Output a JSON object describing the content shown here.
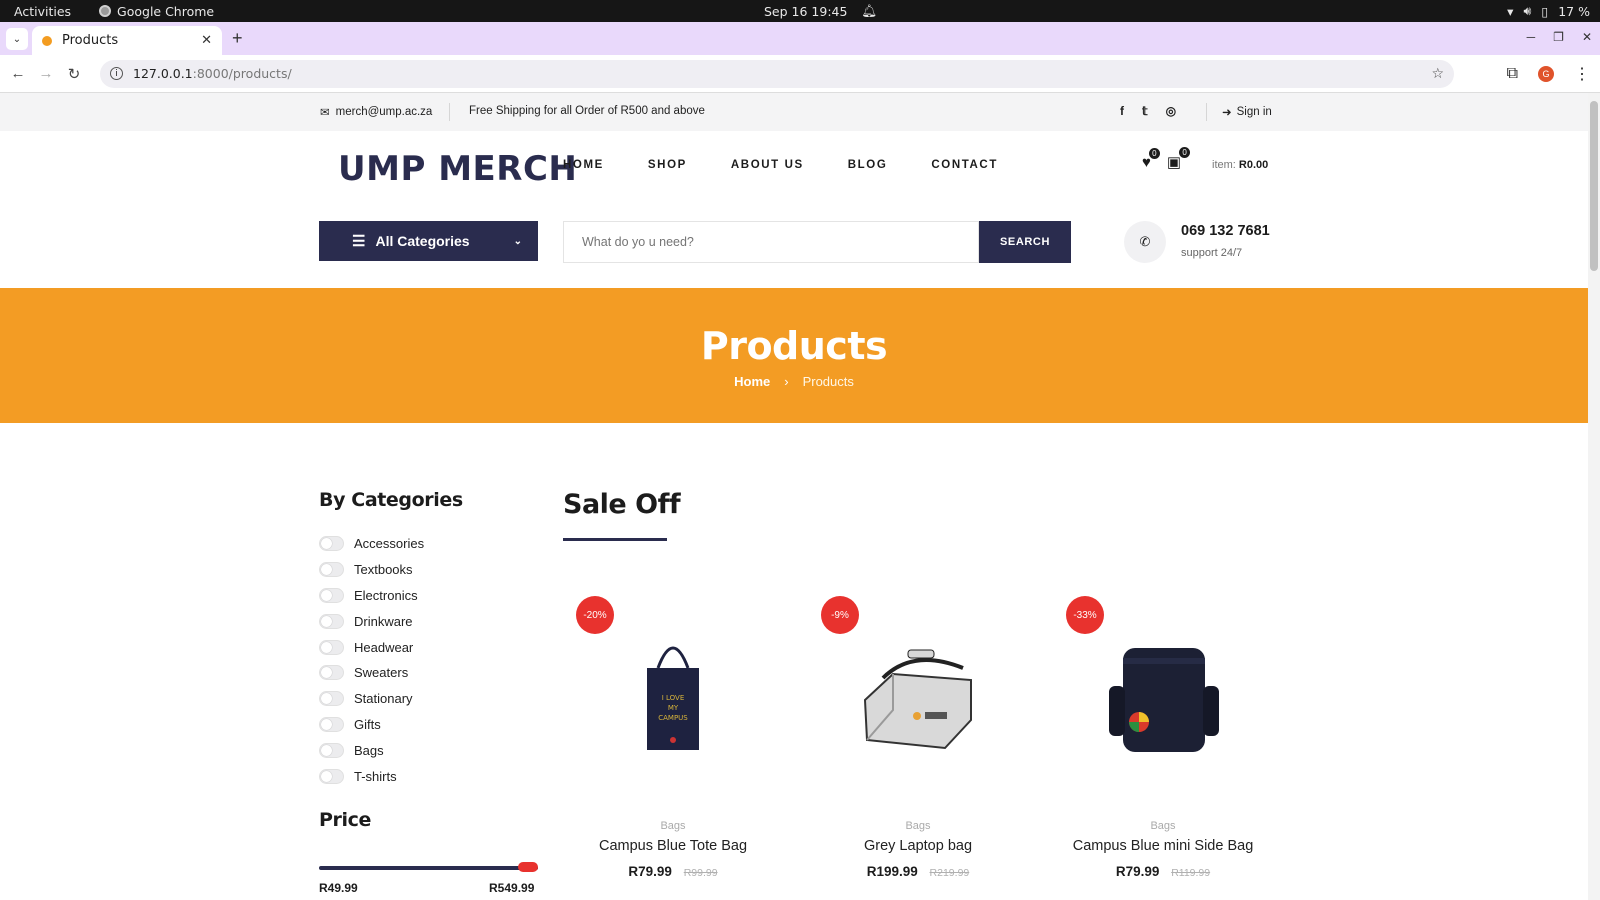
{
  "os": {
    "activities": "Activities",
    "app": "Google Chrome",
    "date": "Sep 16  19:45",
    "battery": "17 %"
  },
  "browser": {
    "tab_title": "Products",
    "url_host": "127.0.0.1",
    "url_path": ":8000/products/"
  },
  "topbar": {
    "email": "merch@ump.ac.za",
    "shipping": "Free Shipping for all Order of R500 and above",
    "signin": "Sign in"
  },
  "header": {
    "logo": "UMP MERCH",
    "nav": [
      "HOME",
      "SHOP",
      "ABOUT US",
      "BLOG",
      "CONTACT"
    ],
    "wishlist_count": "0",
    "cart_count": "0",
    "item_label": "item:",
    "item_total": "R0.00",
    "all_categories": "All Categories",
    "search_placeholder": "What do yo u need?",
    "search_button": "SEARCH",
    "phone": "069 132 7681",
    "support": "support 24/7"
  },
  "hero": {
    "title": "Products",
    "crumb_home": "Home",
    "crumb_sep": "›",
    "crumb_current": "Products"
  },
  "sidebar": {
    "categories_title": "By Categories",
    "categories": [
      "Accessories",
      "Textbooks",
      "Electronics",
      "Drinkware",
      "Headwear",
      "Sweaters",
      "Stationary",
      "Gifts",
      "Bags",
      "T-shirts"
    ],
    "price_title": "Price",
    "price_min": "R49.99",
    "price_max": "R549.99"
  },
  "sale": {
    "title": "Sale Off",
    "products": [
      {
        "discount": "-20%",
        "category": "Bags",
        "name": "Campus Blue Tote Bag",
        "price": "R79.99",
        "old_price": "R99.99"
      },
      {
        "discount": "-9%",
        "category": "Bags",
        "name": "Grey Laptop bag",
        "price": "R199.99",
        "old_price": "R219.99"
      },
      {
        "discount": "-33%",
        "category": "Bags",
        "name": "Campus Blue mini Side Bag",
        "price": "R79.99",
        "old_price": "R119.99"
      }
    ]
  },
  "colors": {
    "brand_navy": "#2a2c4e",
    "hero_orange": "#f39c24",
    "discount_red": "#e8322e"
  }
}
